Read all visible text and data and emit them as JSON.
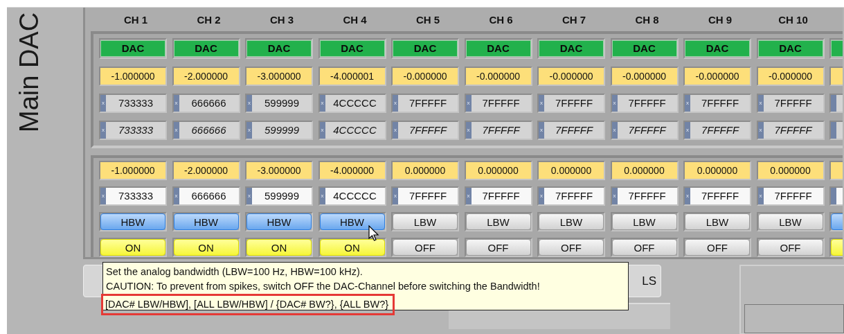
{
  "panel": {
    "title": "Main DAC",
    "channels": [
      {
        "label": "CH 1",
        "mode": "DAC",
        "readback": "-1.000000",
        "hex_readback": {
          "radix": "x",
          "value": "733333"
        },
        "hex_echo": {
          "radix": "x",
          "value": "733333"
        },
        "setpoint": "-1.000000",
        "hex_setpoint": {
          "radix": "x",
          "value": "733333"
        },
        "bandwidth": {
          "label": "HBW",
          "high": true
        },
        "output": {
          "label": "ON",
          "on": true
        }
      },
      {
        "label": "CH 2",
        "mode": "DAC",
        "readback": "-2.000000",
        "hex_readback": {
          "radix": "x",
          "value": "666666"
        },
        "hex_echo": {
          "radix": "x",
          "value": "666666"
        },
        "setpoint": "-2.000000",
        "hex_setpoint": {
          "radix": "x",
          "value": "666666"
        },
        "bandwidth": {
          "label": "HBW",
          "high": true
        },
        "output": {
          "label": "ON",
          "on": true
        }
      },
      {
        "label": "CH 3",
        "mode": "DAC",
        "readback": "-3.000000",
        "hex_readback": {
          "radix": "x",
          "value": "599999"
        },
        "hex_echo": {
          "radix": "x",
          "value": "599999"
        },
        "setpoint": "-3.000000",
        "hex_setpoint": {
          "radix": "x",
          "value": "599999"
        },
        "bandwidth": {
          "label": "HBW",
          "high": true
        },
        "output": {
          "label": "ON",
          "on": true
        }
      },
      {
        "label": "CH 4",
        "mode": "DAC",
        "readback": "-4.000001",
        "hex_readback": {
          "radix": "x",
          "value": "4CCCCC"
        },
        "hex_echo": {
          "radix": "x",
          "value": "4CCCCC"
        },
        "setpoint": "-4.000000",
        "hex_setpoint": {
          "radix": "x",
          "value": "4CCCCC"
        },
        "bandwidth": {
          "label": "HBW",
          "high": true
        },
        "output": {
          "label": "ON",
          "on": true
        }
      },
      {
        "label": "CH 5",
        "mode": "DAC",
        "readback": "-0.000000",
        "hex_readback": {
          "radix": "x",
          "value": "7FFFFF"
        },
        "hex_echo": {
          "radix": "x",
          "value": "7FFFFF"
        },
        "setpoint": "0.000000",
        "hex_setpoint": {
          "radix": "x",
          "value": "7FFFFF"
        },
        "bandwidth": {
          "label": "LBW",
          "high": false
        },
        "output": {
          "label": "OFF",
          "on": false
        }
      },
      {
        "label": "CH 6",
        "mode": "DAC",
        "readback": "-0.000000",
        "hex_readback": {
          "radix": "x",
          "value": "7FFFFF"
        },
        "hex_echo": {
          "radix": "x",
          "value": "7FFFFF"
        },
        "setpoint": "0.000000",
        "hex_setpoint": {
          "radix": "x",
          "value": "7FFFFF"
        },
        "bandwidth": {
          "label": "LBW",
          "high": false
        },
        "output": {
          "label": "OFF",
          "on": false
        }
      },
      {
        "label": "CH 7",
        "mode": "DAC",
        "readback": "-0.000000",
        "hex_readback": {
          "radix": "x",
          "value": "7FFFFF"
        },
        "hex_echo": {
          "radix": "x",
          "value": "7FFFFF"
        },
        "setpoint": "0.000000",
        "hex_setpoint": {
          "radix": "x",
          "value": "7FFFFF"
        },
        "bandwidth": {
          "label": "LBW",
          "high": false
        },
        "output": {
          "label": "OFF",
          "on": false
        }
      },
      {
        "label": "CH 8",
        "mode": "DAC",
        "readback": "-0.000000",
        "hex_readback": {
          "radix": "x",
          "value": "7FFFFF"
        },
        "hex_echo": {
          "radix": "x",
          "value": "7FFFFF"
        },
        "setpoint": "0.000000",
        "hex_setpoint": {
          "radix": "x",
          "value": "7FFFFF"
        },
        "bandwidth": {
          "label": "LBW",
          "high": false
        },
        "output": {
          "label": "OFF",
          "on": false
        }
      },
      {
        "label": "CH 9",
        "mode": "DAC",
        "readback": "-0.000000",
        "hex_readback": {
          "radix": "x",
          "value": "7FFFFF"
        },
        "hex_echo": {
          "radix": "x",
          "value": "7FFFFF"
        },
        "setpoint": "0.000000",
        "hex_setpoint": {
          "radix": "x",
          "value": "7FFFFF"
        },
        "bandwidth": {
          "label": "LBW",
          "high": false
        },
        "output": {
          "label": "OFF",
          "on": false
        }
      },
      {
        "label": "CH 10",
        "mode": "DAC",
        "readback": "-0.000000",
        "hex_readback": {
          "radix": "x",
          "value": "7FFFFF"
        },
        "hex_echo": {
          "radix": "x",
          "value": "7FFFFF"
        },
        "setpoint": "0.000000",
        "hex_setpoint": {
          "radix": "x",
          "value": "7FFFFF"
        },
        "bandwidth": {
          "label": "LBW",
          "high": false
        },
        "output": {
          "label": "OFF",
          "on": false
        }
      },
      {
        "bandwidth": {
          "high": true
        },
        "output": {
          "on": true
        }
      }
    ],
    "tooltip": {
      "lines": [
        {
          "text": "Set the analog bandwidth (LBW=100 Hz, HBW=100 kHz).",
          "highlighted": false
        },
        {
          "text": "CAUTION: To prevent from spikes, switch OFF the DAC-Channel before switching the Bandwidth!",
          "highlighted": false
        },
        {
          "text": "[DAC# LBW/HBW], [ALL LBW/HBW] / {DAC# BW?}, {ALL BW?}",
          "highlighted": true
        }
      ]
    },
    "covered_button": {
      "label": "LS"
    }
  }
}
